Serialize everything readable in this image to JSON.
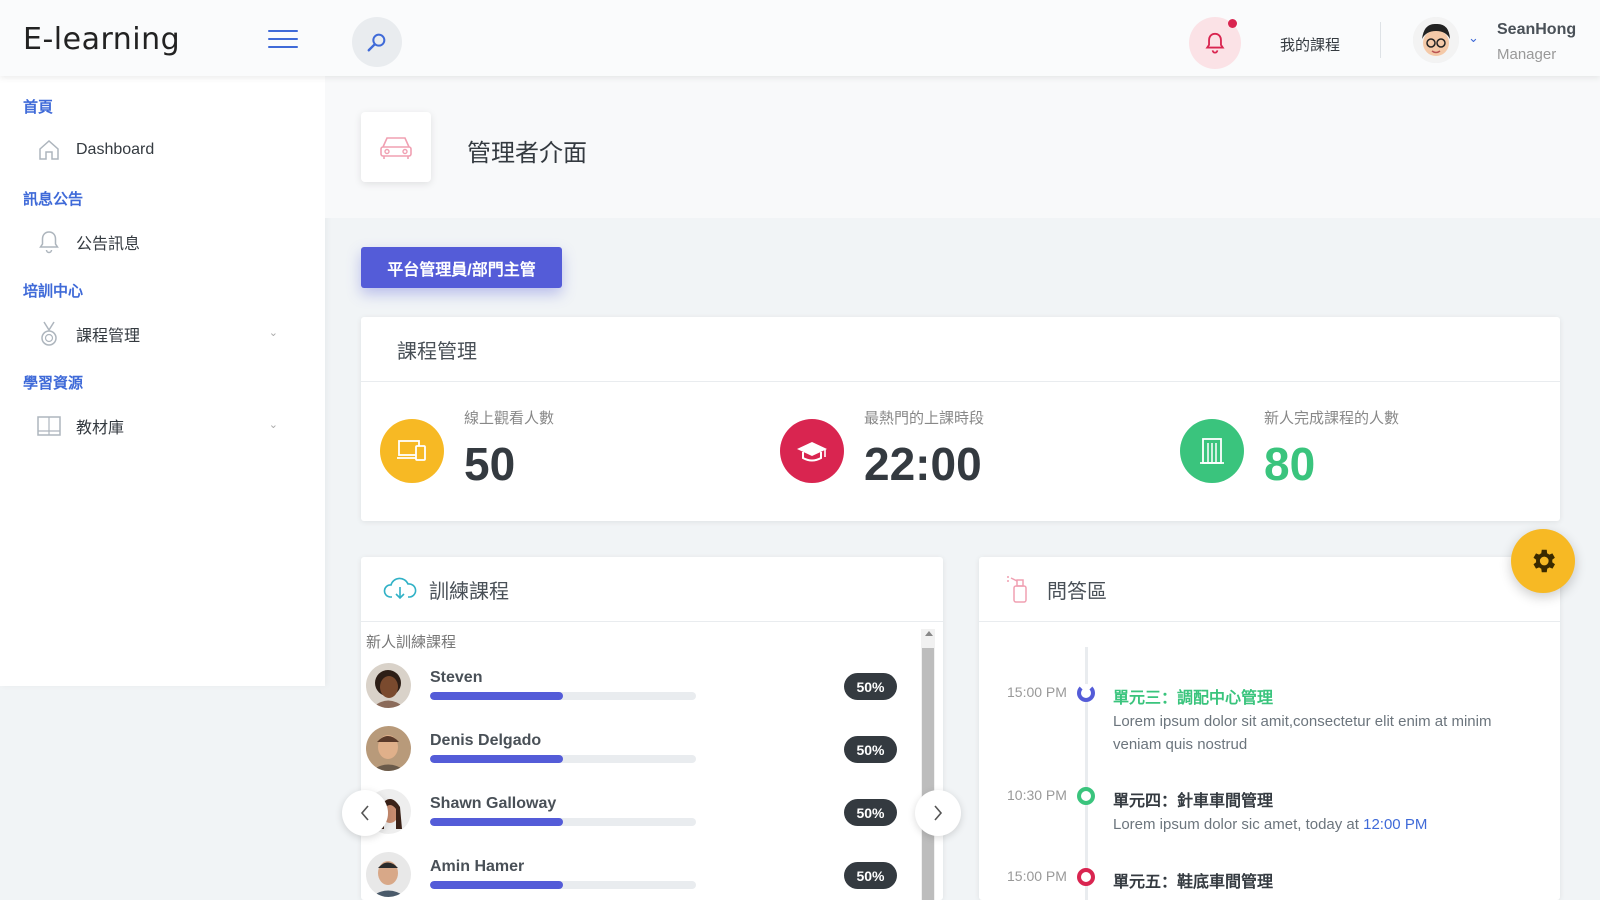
{
  "app": {
    "logo": "E-learning"
  },
  "header": {
    "my_courses": "我的課程",
    "user_name": "SeanHong",
    "user_role": "Manager"
  },
  "sidebar": {
    "sections": [
      {
        "heading": "首頁",
        "items": [
          {
            "label": "Dashboard",
            "icon": "home-icon"
          }
        ]
      },
      {
        "heading": "訊息公告",
        "items": [
          {
            "label": "公告訊息",
            "icon": "bell-icon"
          }
        ]
      },
      {
        "heading": "培訓中心",
        "items": [
          {
            "label": "課程管理",
            "icon": "medal-icon",
            "expandable": true
          }
        ]
      },
      {
        "heading": "學習資源",
        "items": [
          {
            "label": "教材庫",
            "icon": "book-icon",
            "expandable": true
          }
        ]
      }
    ]
  },
  "page": {
    "title": "管理者介面",
    "role_button": "平台管理員/部門主管"
  },
  "course_mgmt": {
    "title": "課程管理",
    "stats": [
      {
        "label": "線上觀看人數",
        "value": "50",
        "color": "#f7b924",
        "icon": "devices-icon"
      },
      {
        "label": "最熱門的上課時段",
        "value": "22:00",
        "color": "#d92550",
        "icon": "graduation-cap-icon"
      },
      {
        "label": "新人完成課程的人數",
        "value": "80",
        "color": "#3ac47d",
        "icon": "building-icon"
      }
    ]
  },
  "training": {
    "title": "訓練課程",
    "list_label": "新人訓練課程",
    "people": [
      {
        "name": "Steven",
        "progress": 0.5,
        "badge": "50%"
      },
      {
        "name": "Denis Delgado",
        "progress": 0.5,
        "badge": "50%"
      },
      {
        "name": "Shawn Galloway",
        "progress": 0.5,
        "badge": "50%"
      },
      {
        "name": "Amin Hamer",
        "progress": 0.5,
        "badge": "50%"
      }
    ]
  },
  "qa": {
    "title": "問答區",
    "timeline": [
      {
        "time": "15:00 PM",
        "title": "單元三：調配中心管理",
        "title_color": "#3ac47d",
        "dot_color": "#545cd8",
        "desc": "Lorem ipsum dolor sit amit,consectetur elit enim at minim veniam quis nostrud"
      },
      {
        "time": "10:30 PM",
        "title": "單元四：針車車間管理",
        "title_color": "#343a40",
        "dot_color": "#3ac47d",
        "desc_prefix": "Lorem ipsum dolor sic amet, today at ",
        "desc_link": "12:00 PM"
      },
      {
        "time": "15:00 PM",
        "title": "單元五：鞋底車間管理",
        "title_color": "#343a40",
        "dot_color": "#d92550"
      }
    ]
  },
  "colors": {
    "primary": "#545cd8",
    "accent": "#3f6ad8",
    "warning": "#f7b924",
    "danger": "#d92550",
    "success": "#3ac47d"
  }
}
